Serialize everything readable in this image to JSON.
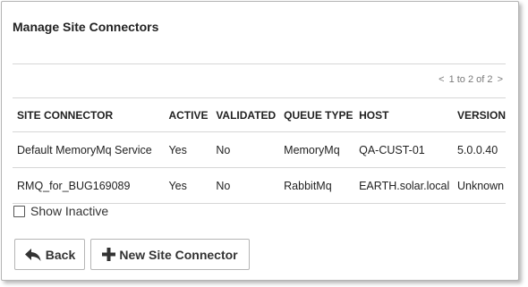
{
  "panel": {
    "title": "Manage Site Connectors",
    "pager": {
      "prev": "<",
      "range": "1 to 2 of 2",
      "next": ">"
    }
  },
  "table": {
    "headers": [
      "SITE CONNECTOR",
      "ACTIVE",
      "VALIDATED",
      "QUEUE TYPE",
      "HOST",
      "VERSION"
    ],
    "rows": [
      [
        "Default MemoryMq Service",
        "Yes",
        "No",
        "MemoryMq",
        "QA-CUST-01",
        "5.0.0.40"
      ],
      [
        "RMQ_for_BUG169089",
        "Yes",
        "No",
        "RabbitMq",
        "EARTH.solar.local",
        "Unknown"
      ]
    ]
  },
  "show_inactive": {
    "label": "Show Inactive",
    "checked": false
  },
  "buttons": {
    "back": {
      "label": "Back",
      "icon": "reply-arrow-icon"
    },
    "new_connector": {
      "label": "New Site Connector",
      "icon": "plus-icon"
    }
  }
}
